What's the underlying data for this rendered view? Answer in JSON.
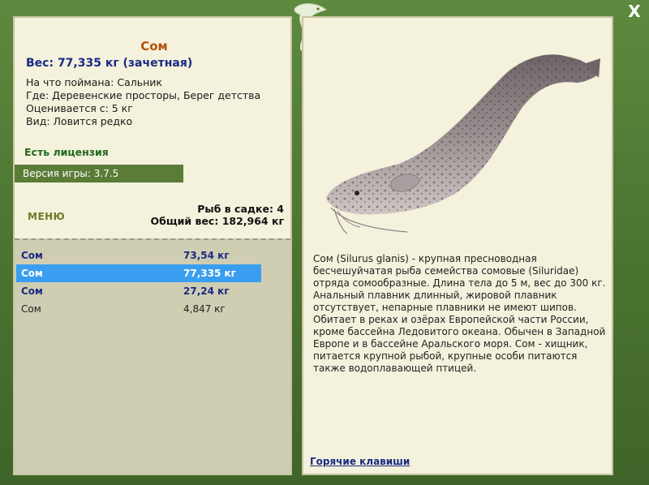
{
  "window": {
    "close_label": "X"
  },
  "fish": {
    "title": "Сом",
    "weight": "Вес: 77,335 кг (зачетная)",
    "bait": "На что поймана: Сальник",
    "location": "Где: Деревенские просторы, Берег детства",
    "valued": "Оценивается с: 5 кг",
    "kind": "Вид: Ловится редко"
  },
  "license": "Есть лицензия",
  "version": "Версия игры: 3.7.5",
  "menu_label": "МЕНЮ",
  "cage": {
    "count": "Рыб в садке: 4",
    "total": "Общий вес: 182,964 кг"
  },
  "catches": [
    {
      "name": "Сом",
      "weight": "73,54 кг"
    },
    {
      "name": "Сом",
      "weight": "77,335 кг"
    },
    {
      "name": "Сом",
      "weight": "27,24 кг"
    },
    {
      "name": "Сом",
      "weight": "4,847 кг"
    }
  ],
  "description": "Сом (Silurus glanis) - крупная пресноводная бесчешуйчатая рыба семейства сомовые (Siluridae) отряда сомообразные. Длина тела до 5 м, вес до 300 кг. Анальный плавник длинный, жировой плавник отсутствует, непарные плавники не имеют шипов. Обитает в реках и озёрах Европейской части России, кроме бассейна Ледовитого океана. Обычен в Западной Европе и в бассейне Аральского моря. Сом - хищник, питается крупной рыбой, крупные особи питаются также водоплавающей птицей.",
  "hotkeys_label": "Горячие клавиши",
  "colors": {
    "frame": "#4f7a35",
    "panel": "#f4f1dc",
    "selected": "#3a9ef0",
    "title": "#b4520e",
    "link": "#1a2a84"
  }
}
